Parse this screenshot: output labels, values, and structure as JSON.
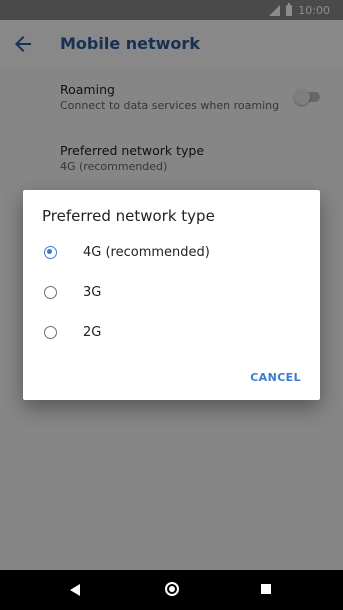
{
  "status_bar": {
    "time": "10:00",
    "icons": [
      "signal-icon",
      "battery-icon"
    ]
  },
  "app_bar": {
    "title": "Mobile network",
    "back_icon": "arrow-back-icon"
  },
  "settings": [
    {
      "title": "Roaming",
      "subtitle": "Connect to data services when roaming",
      "toggle": false
    },
    {
      "title": "Preferred network type",
      "subtitle": "4G (recommended)"
    }
  ],
  "dialog": {
    "title": "Preferred network type",
    "options": [
      {
        "label": "4G (recommended)",
        "selected": true
      },
      {
        "label": "3G",
        "selected": false
      },
      {
        "label": "2G",
        "selected": false
      }
    ],
    "cancel_label": "CANCEL"
  },
  "nav_bar": {
    "icons": [
      "back-icon",
      "home-icon",
      "recents-icon"
    ]
  },
  "colors": {
    "accent": "#3a7bd5",
    "title": "#2a5a9b"
  }
}
